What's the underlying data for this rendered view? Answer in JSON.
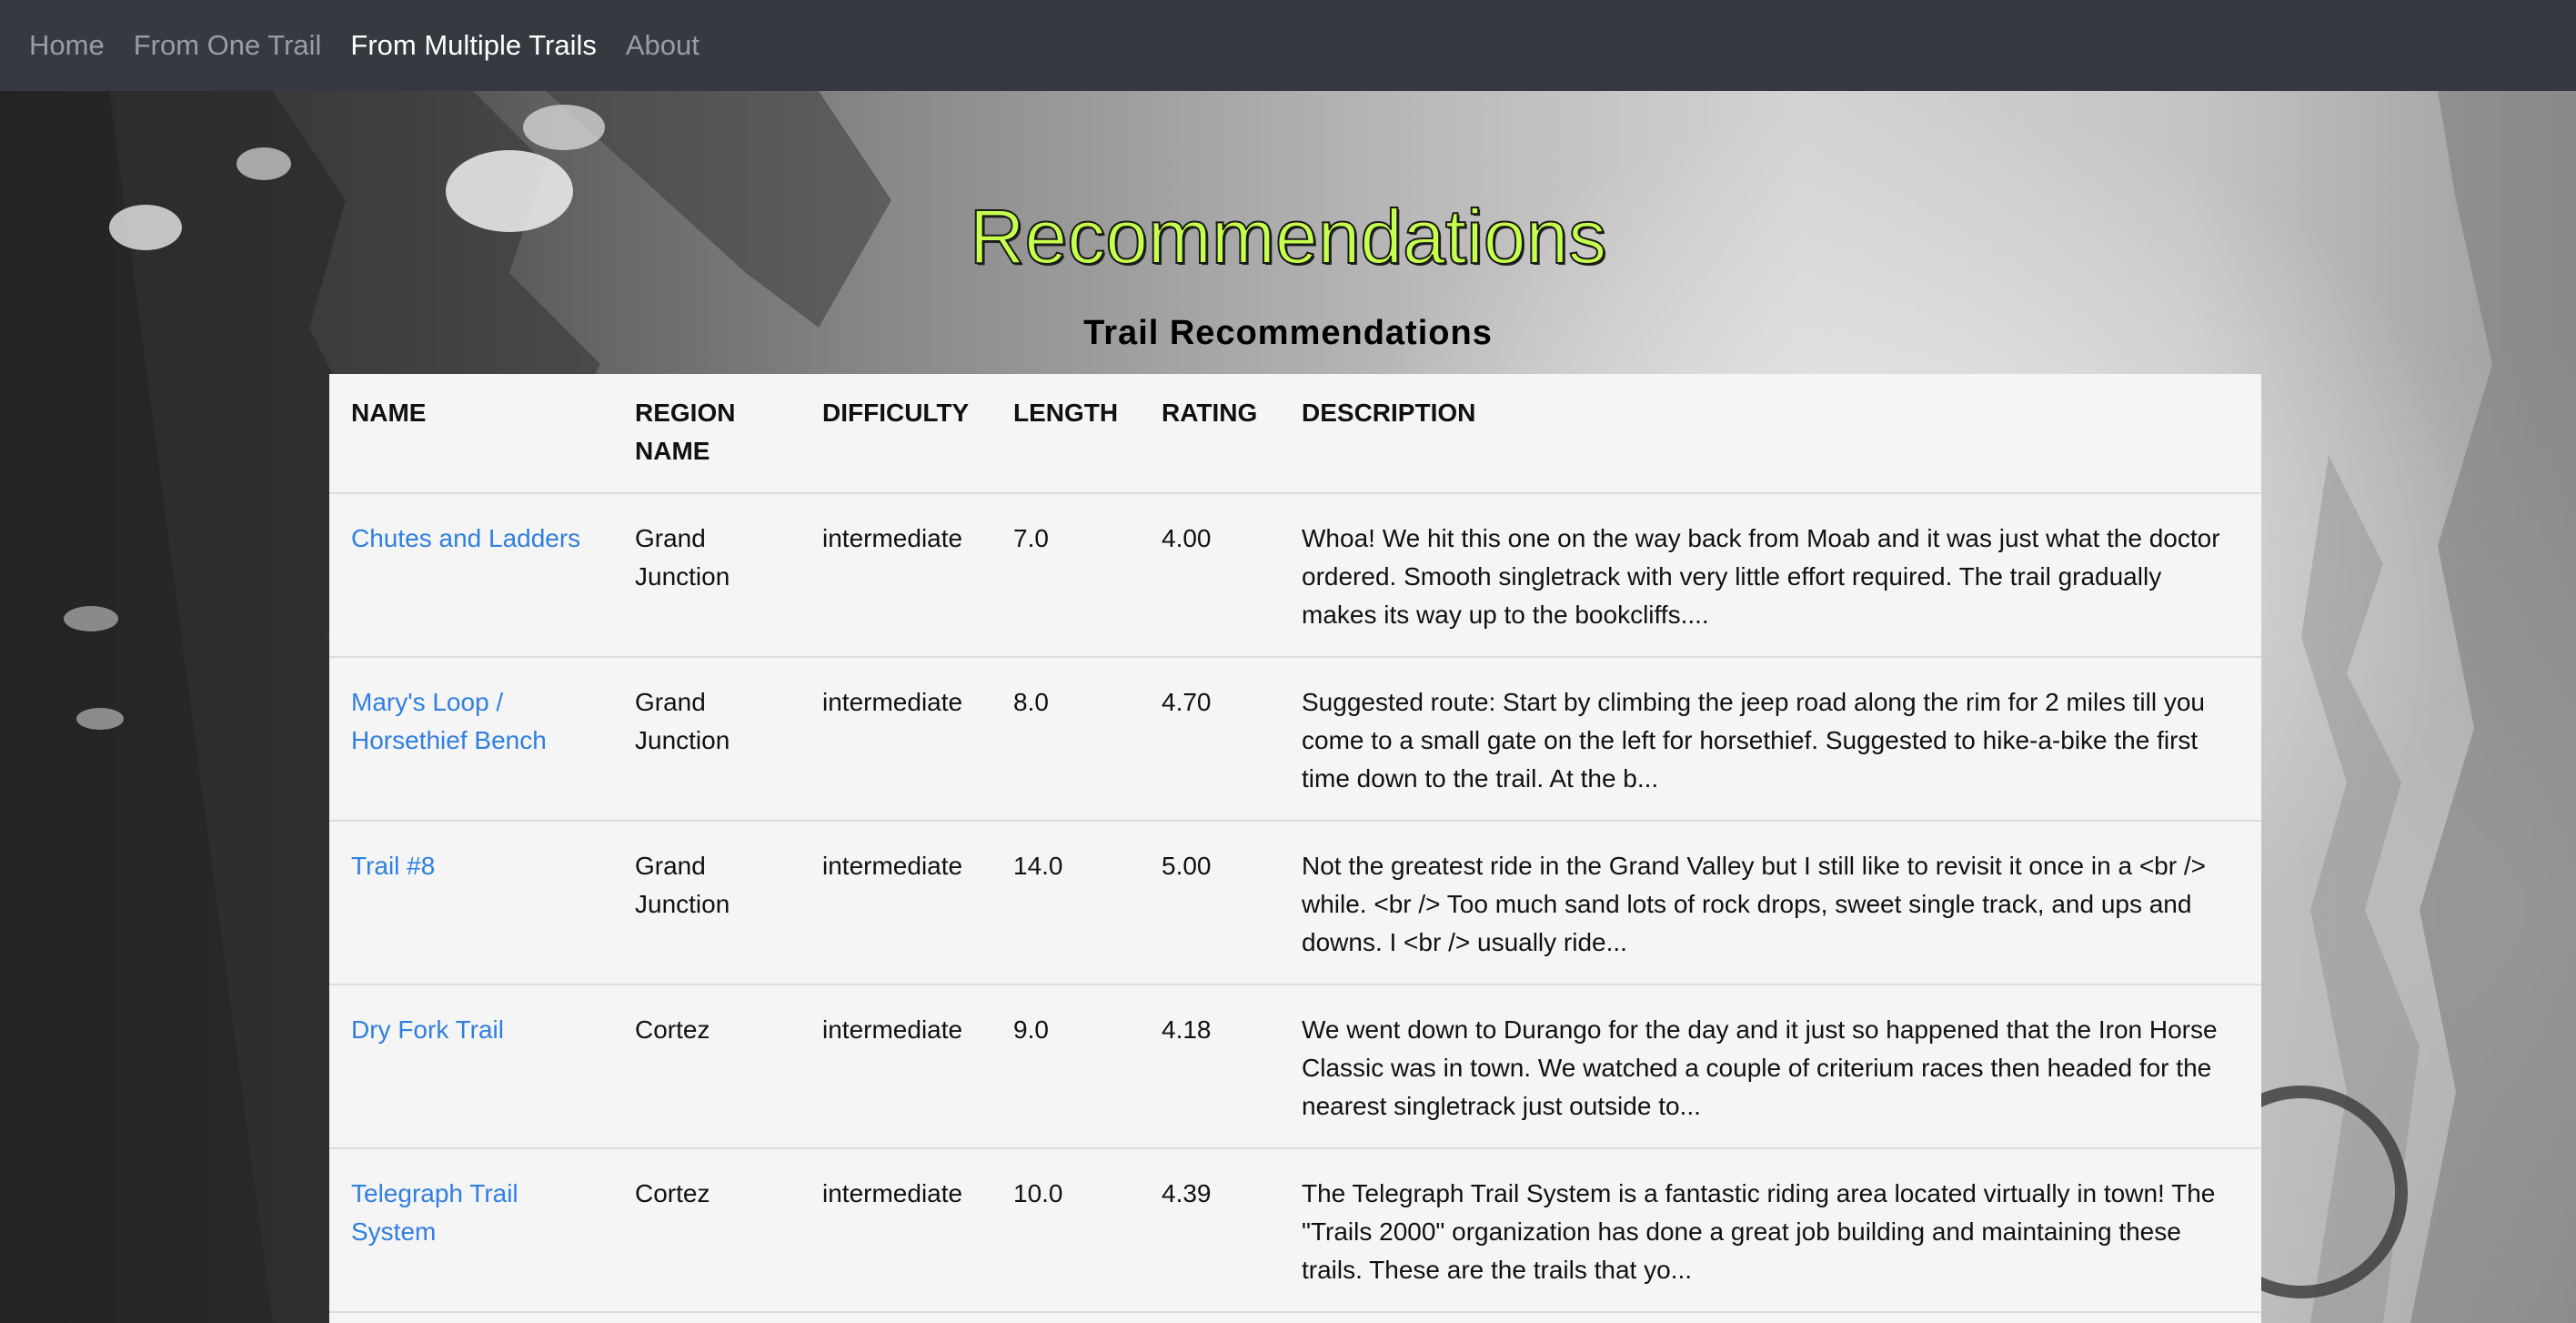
{
  "nav": {
    "items": [
      {
        "label": "Home",
        "active": false
      },
      {
        "label": "From One Trail",
        "active": false
      },
      {
        "label": "From Multiple Trails",
        "active": true
      },
      {
        "label": "About",
        "active": false
      }
    ]
  },
  "page": {
    "title": "Recommendations",
    "subtitle": "Trail Recommendations"
  },
  "table": {
    "headers": [
      "NAME",
      "REGION NAME",
      "DIFFICULTY",
      "LENGTH",
      "RATING",
      "DESCRIPTION"
    ],
    "rows": [
      {
        "name": "Chutes and Ladders",
        "region": "Grand Junction",
        "difficulty": "intermediate",
        "length": "7.0",
        "rating": "4.00",
        "description": "Whoa! We hit this one on the way back from Moab and it was just what the doctor ordered. Smooth singletrack with very little effort required. The trail gradually makes its way up to the bookcliffs...."
      },
      {
        "name": "Mary's Loop / Horsethief Bench",
        "region": "Grand Junction",
        "difficulty": "intermediate",
        "length": "8.0",
        "rating": "4.70",
        "description": "Suggested route: Start by climbing the jeep road along the rim for 2 miles till you come to a small gate on the left for horsethief. Suggested to hike-a-bike the first time down to the trail. At the b..."
      },
      {
        "name": "Trail #8",
        "region": "Grand Junction",
        "difficulty": "intermediate",
        "length": "14.0",
        "rating": "5.00",
        "description": "Not the greatest ride in the Grand Valley but I still like to revisit it once in a <br /> while. <br /> Too much sand lots of rock drops, sweet single track, and ups and downs. I <br /> usually ride..."
      },
      {
        "name": "Dry Fork Trail",
        "region": "Cortez",
        "difficulty": "intermediate",
        "length": "9.0",
        "rating": "4.18",
        "description": "We went down to Durango for the day and it just so happened that the Iron Horse Classic was in town. We watched a couple of criterium races then headed for the nearest singletrack just outside to..."
      },
      {
        "name": "Telegraph Trail System",
        "region": "Cortez",
        "difficulty": "intermediate",
        "length": "10.0",
        "rating": "4.39",
        "description": "The Telegraph Trail System is a fantastic riding area located virtually in town! The \"Trails 2000\" organization has done a great job building and maintaining these trails. These are the trails that yo..."
      }
    ]
  }
}
